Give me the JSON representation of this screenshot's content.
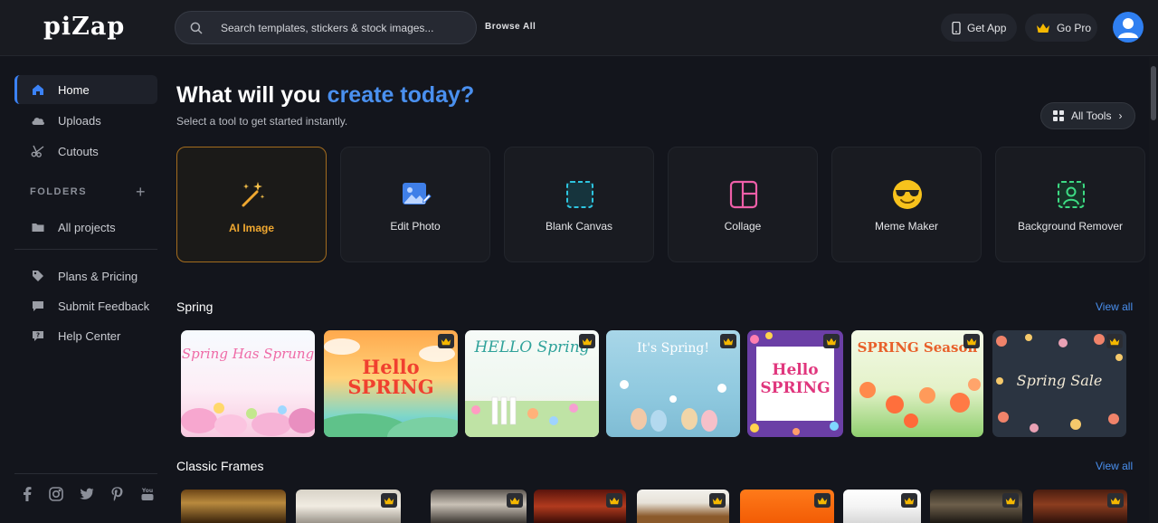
{
  "header": {
    "logo": "piZap",
    "search_placeholder": "Search templates, stickers & stock images...",
    "browse_all": "Browse All",
    "get_app": "Get App",
    "go_pro": "Go Pro"
  },
  "sidebar": {
    "items": [
      {
        "label": "Home",
        "icon": "home-icon"
      },
      {
        "label": "Uploads",
        "icon": "cloud-upload-icon"
      },
      {
        "label": "Cutouts",
        "icon": "scissors-icon"
      }
    ],
    "folders_label": "FOLDERS",
    "folders": [
      {
        "label": "All projects",
        "icon": "folder-icon"
      }
    ],
    "links": [
      {
        "label": "Plans & Pricing",
        "icon": "tag-icon"
      },
      {
        "label": "Submit Feedback",
        "icon": "chat-icon"
      },
      {
        "label": "Help Center",
        "icon": "help-icon"
      }
    ],
    "social": [
      "facebook-icon",
      "instagram-icon",
      "twitter-icon",
      "pinterest-icon",
      "youtube-icon"
    ]
  },
  "main": {
    "title_prefix": "What will you ",
    "title_accent": "create today?",
    "subtitle": "Select a tool to get started instantly.",
    "all_tools": "All Tools",
    "tools": [
      {
        "label": "AI Image",
        "icon": "magic-wand-icon"
      },
      {
        "label": "Edit Photo",
        "icon": "image-edit-icon"
      },
      {
        "label": "Blank Canvas",
        "icon": "blank-canvas-icon"
      },
      {
        "label": "Collage",
        "icon": "collage-icon"
      },
      {
        "label": "Meme Maker",
        "icon": "sunglasses-emoji-icon"
      },
      {
        "label": "Background Remover",
        "icon": "person-cutout-icon"
      }
    ],
    "spring": {
      "title": "Spring",
      "view_all": "View all",
      "cards": [
        {
          "text": "Spring Has Sprung",
          "premium": false
        },
        {
          "text": "Hello SPRING",
          "premium": true
        },
        {
          "text": "HELLO Spring",
          "premium": true
        },
        {
          "text": "It's Spring!",
          "premium": true
        },
        {
          "text": "Hello SPRING",
          "premium": true
        },
        {
          "text": "SPRING Season",
          "premium": true
        },
        {
          "text": "Spring Sale",
          "premium": true
        }
      ]
    },
    "classic_frames": {
      "title": "Classic Frames",
      "view_all": "View all"
    }
  },
  "colors": {
    "accent": "#4a90ef",
    "ai_highlight": "#f0a830",
    "crown": "#f5b800",
    "background": "#13151c"
  }
}
